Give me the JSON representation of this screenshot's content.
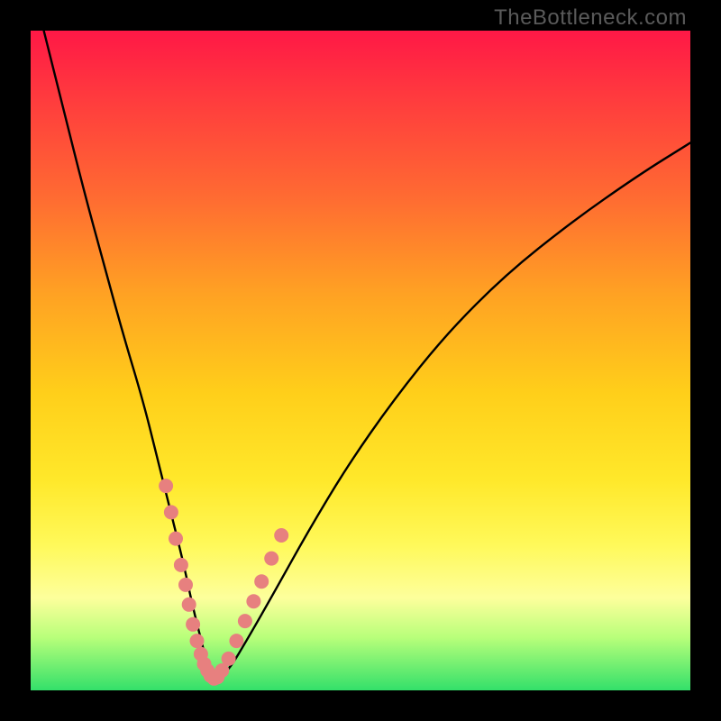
{
  "watermark": "TheBottleneck.com",
  "chart_data": {
    "type": "line",
    "title": "",
    "xlabel": "",
    "ylabel": "",
    "xlim": [
      0,
      100
    ],
    "ylim": [
      0,
      100
    ],
    "series": [
      {
        "name": "bottleneck-curve",
        "x": [
          2,
          5,
          8,
          11,
          14,
          17,
          19,
          21,
          23,
          24.5,
          26,
          27,
          28,
          30,
          33,
          37,
          42,
          48,
          55,
          63,
          72,
          82,
          92,
          100
        ],
        "values": [
          100,
          88,
          76,
          65,
          54,
          44,
          36,
          28,
          20,
          13,
          7,
          3,
          1.5,
          3,
          8,
          15,
          24,
          34,
          44,
          54,
          63,
          71,
          78,
          83
        ]
      }
    ],
    "markers": {
      "name": "highlighted-points",
      "color": "#e7807f",
      "x": [
        20.5,
        21.3,
        22.0,
        22.8,
        23.5,
        24.0,
        24.6,
        25.2,
        25.8,
        26.3,
        26.8,
        27.3,
        27.8,
        28.3,
        29.0,
        30.0,
        31.2,
        32.5,
        33.8,
        35.0,
        36.5,
        38.0
      ],
      "values": [
        31,
        27,
        23,
        19,
        16,
        13,
        10,
        7.5,
        5.5,
        4.0,
        3.0,
        2.2,
        1.8,
        2.0,
        3.0,
        4.8,
        7.5,
        10.5,
        13.5,
        16.5,
        20.0,
        23.5
      ]
    }
  }
}
